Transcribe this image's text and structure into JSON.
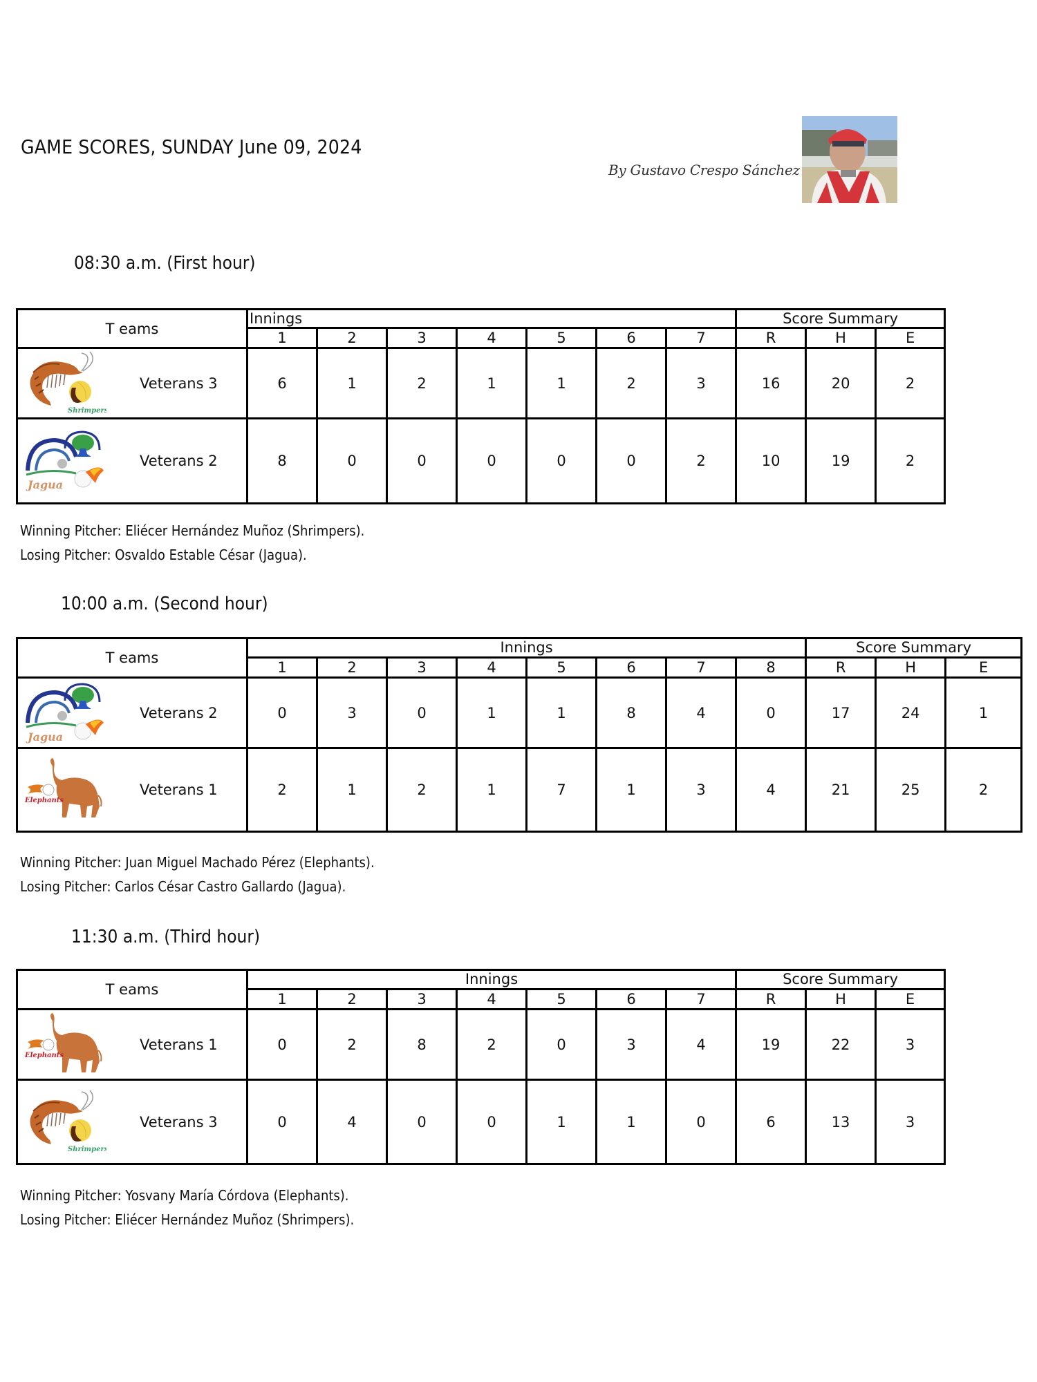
{
  "header": {
    "title": "GAME SCORES, SUNDAY June 09, 2024",
    "byline": "By Gustavo Crespo Sánchez",
    "author_photo": "author-photo"
  },
  "labels": {
    "teams": "T eams",
    "innings": "Innings",
    "score_summary": "Score Summary",
    "runs": "R",
    "hits": "H",
    "errors": "E"
  },
  "games": [
    {
      "time": "08:30 a.m. (First hour)",
      "innings": [
        "1",
        "2",
        "3",
        "4",
        "5",
        "6",
        "7"
      ],
      "teams": [
        {
          "name": "Veterans 3",
          "logo": "shrimpers",
          "logo_text": "Shrimpers",
          "scores": [
            "6",
            "1",
            "2",
            "1",
            "1",
            "2",
            "3"
          ],
          "R": "16",
          "H": "20",
          "E": "2"
        },
        {
          "name": "Veterans 2",
          "logo": "jagua",
          "logo_text": "Jagua",
          "scores": [
            "8",
            "0",
            "0",
            "0",
            "0",
            "0",
            "2"
          ],
          "R": "10",
          "H": "19",
          "E": "2"
        }
      ],
      "winning_pitcher": "Winning Pitcher: Eliécer Hernández Muñoz (Shrimpers).",
      "losing_pitcher": "Losing Pitcher: Osvaldo Estable César (Jagua)."
    },
    {
      "time": "10:00 a.m. (Second hour)",
      "innings": [
        "1",
        "2",
        "3",
        "4",
        "5",
        "6",
        "7",
        "8"
      ],
      "teams": [
        {
          "name": "Veterans 2",
          "logo": "jagua",
          "logo_text": "Jagua",
          "scores": [
            "0",
            "3",
            "0",
            "1",
            "1",
            "8",
            "4",
            "0"
          ],
          "R": "17",
          "H": "24",
          "E": "1"
        },
        {
          "name": "Veterans 1",
          "logo": "elephants",
          "logo_text": "Elephants",
          "scores": [
            "2",
            "1",
            "2",
            "1",
            "7",
            "1",
            "3",
            "4"
          ],
          "R": "21",
          "H": "25",
          "E": "2"
        }
      ],
      "winning_pitcher": "Winning Pitcher: Juan Miguel Machado Pérez (Elephants).",
      "losing_pitcher": "Losing Pitcher: Carlos César Castro Gallardo (Jagua)."
    },
    {
      "time": "11:30 a.m. (Third hour)",
      "innings": [
        "1",
        "2",
        "3",
        "4",
        "5",
        "6",
        "7"
      ],
      "teams": [
        {
          "name": "Veterans 1",
          "logo": "elephants",
          "logo_text": "Elephants",
          "scores": [
            "0",
            "2",
            "8",
            "2",
            "0",
            "3",
            "4"
          ],
          "R": "19",
          "H": "22",
          "E": "3"
        },
        {
          "name": "Veterans 3",
          "logo": "shrimpers",
          "logo_text": "Shrimpers",
          "scores": [
            "0",
            "4",
            "0",
            "0",
            "1",
            "1",
            "0"
          ],
          "R": "6",
          "H": "13",
          "E": "3"
        }
      ],
      "winning_pitcher": "Winning Pitcher: Yosvany María Córdova (Elephants).",
      "losing_pitcher": "Losing Pitcher: Eliécer Hernández Muñoz (Shrimpers)."
    }
  ]
}
